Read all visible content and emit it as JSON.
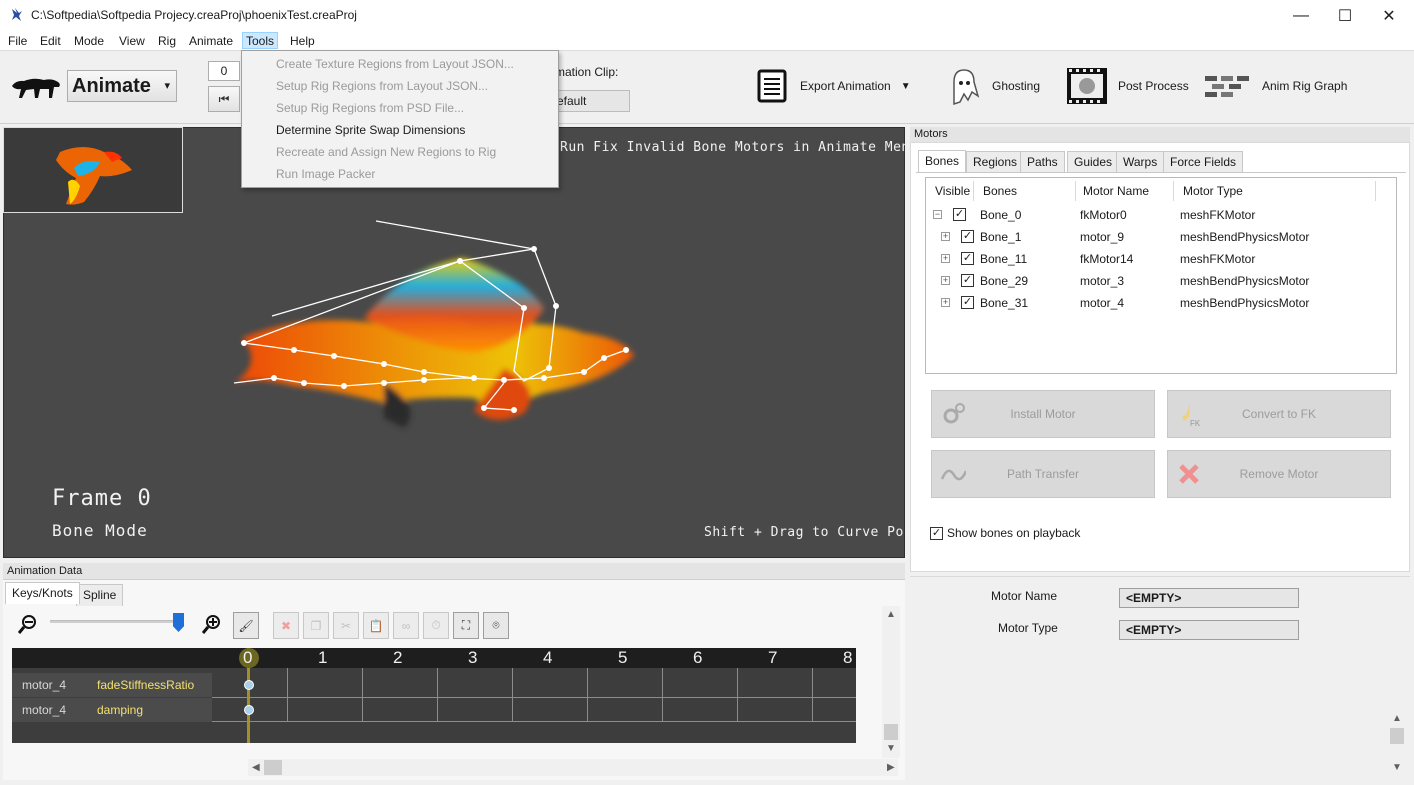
{
  "window": {
    "title": "C:\\Softpedia\\Softpedia Projecy.creaProj\\phoenixTest.creaProj",
    "minimize": "—",
    "maximize": "☐",
    "close": "✕"
  },
  "menubar": [
    "File",
    "Edit",
    "Mode",
    "View",
    "Rig",
    "Animate",
    "Tools",
    "Help"
  ],
  "tools_menu": {
    "items": [
      {
        "label": "Create Texture Regions from Layout JSON...",
        "enabled": false
      },
      {
        "label": "Setup Rig Regions from Layout JSON...",
        "enabled": false
      },
      {
        "label": "Setup Rig Regions from PSD File...",
        "enabled": false
      },
      {
        "label": "Determine Sprite Swap Dimensions",
        "enabled": true
      },
      {
        "label": "Recreate and Assign New Regions to Rig",
        "enabled": false
      },
      {
        "label": "Run Image Packer",
        "enabled": false
      }
    ]
  },
  "toolbar": {
    "mode": "Animate",
    "frame_value": "0",
    "clip_label": "mation Clip:",
    "clip_value": "efault",
    "export_label": "Export Animation",
    "ghosting_label": "Ghosting",
    "post_process_label": "Post Process",
    "anim_rig_graph_label": "Anim Rig Graph"
  },
  "viewport": {
    "hint_top": "Run Fix Invalid Bone Motors in Animate Menu",
    "frame_label": "Frame 0",
    "mode_label": "Bone Mode",
    "hint_bottom": "Shift + Drag to Curve Pose"
  },
  "animation_data": {
    "header": "Animation Data",
    "tabs": [
      "Keys/Knots",
      "Spline"
    ],
    "ticks": [
      "0",
      "1",
      "2",
      "3",
      "4",
      "5",
      "6",
      "7",
      "8"
    ],
    "tracks": [
      {
        "motor": "motor_4",
        "property": "fadeStiffnessRatio"
      },
      {
        "motor": "motor_4",
        "property": "damping"
      }
    ]
  },
  "motors": {
    "header": "Motors",
    "tabs": [
      "Bones",
      "Regions",
      "Paths",
      "Guides",
      "Warps",
      "Force Fields"
    ],
    "columns": [
      "Visible",
      "Bones",
      "Motor Name",
      "Motor Type"
    ],
    "rows": [
      {
        "bone": "Bone_0",
        "motor_name": "fkMotor0",
        "motor_type": "meshFKMotor",
        "expander": "−",
        "visible": true
      },
      {
        "bone": "Bone_1",
        "motor_name": "motor_9",
        "motor_type": "meshBendPhysicsMotor",
        "expander": "+",
        "visible": true
      },
      {
        "bone": "Bone_11",
        "motor_name": "fkMotor14",
        "motor_type": "meshFKMotor",
        "expander": "+",
        "visible": true
      },
      {
        "bone": "Bone_29",
        "motor_name": "motor_3",
        "motor_type": "meshBendPhysicsMotor",
        "expander": "+",
        "visible": true
      },
      {
        "bone": "Bone_31",
        "motor_name": "motor_4",
        "motor_type": "meshBendPhysicsMotor",
        "expander": "+",
        "visible": true
      }
    ],
    "buttons": {
      "install": "Install Motor",
      "convert": "Convert to FK",
      "path_transfer": "Path Transfer",
      "remove": "Remove Motor"
    },
    "show_bones_label": "Show bones on playback",
    "show_bones_checked": true
  },
  "properties": {
    "motor_name_label": "Motor Name",
    "motor_name_value": "<EMPTY>",
    "motor_type_label": "Motor Type",
    "motor_type_value": "<EMPTY>"
  },
  "colors": {
    "viewport_bg": "#494949",
    "accent_blue": "#1e6fd8",
    "track_property": "#f2e071"
  }
}
